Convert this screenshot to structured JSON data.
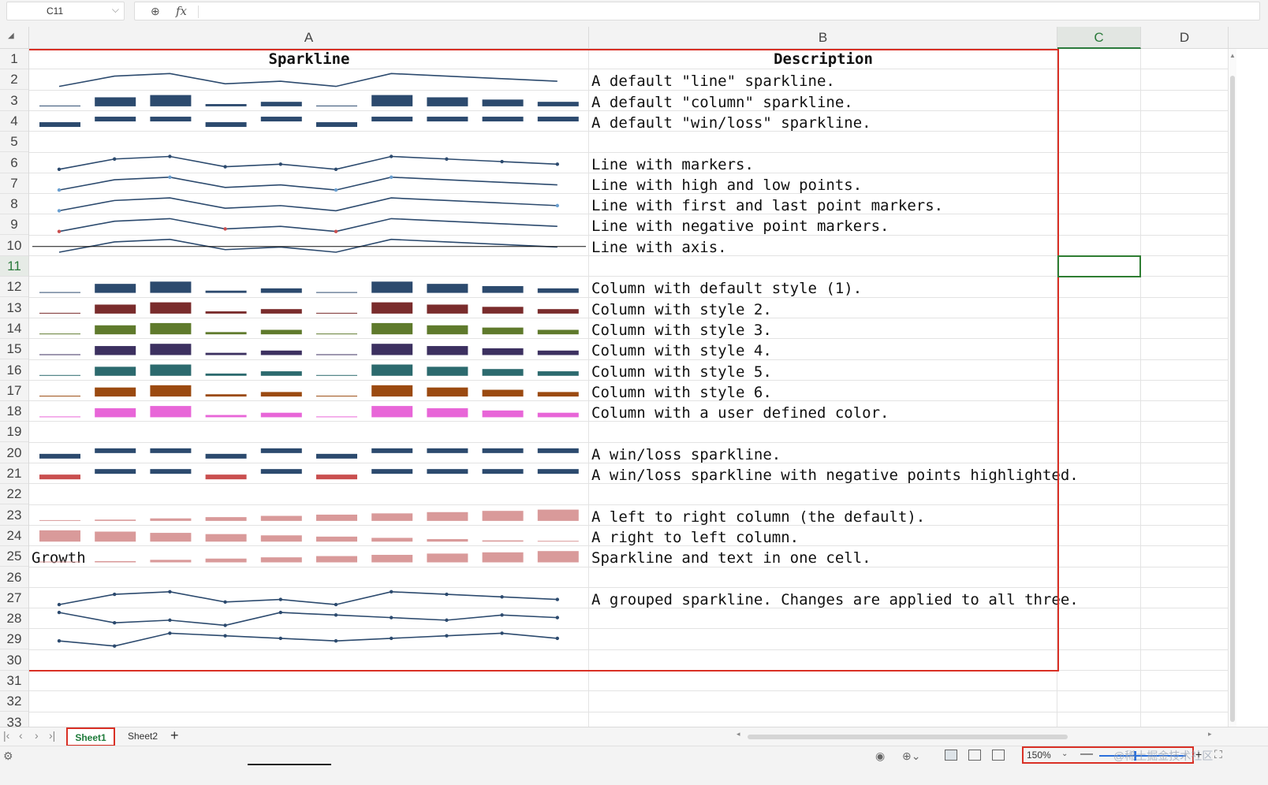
{
  "formula_bar": {
    "name_box": "C11",
    "fx": "fx",
    "content": ""
  },
  "columns": [
    "A",
    "B",
    "C",
    "D"
  ],
  "selected_column": "C",
  "selected_row": 11,
  "rows": [
    1,
    2,
    3,
    4,
    5,
    6,
    7,
    8,
    9,
    10,
    11,
    12,
    13,
    14,
    15,
    16,
    17,
    18,
    19,
    20,
    21,
    22,
    23,
    24,
    25,
    26,
    27,
    28,
    29,
    30,
    31,
    32,
    33
  ],
  "header": {
    "a": "Sparkline",
    "b": "Description"
  },
  "cells": [
    {
      "row": 2,
      "text": "A default \"line\" sparkline."
    },
    {
      "row": 3,
      "text": "A default \"column\" sparkline."
    },
    {
      "row": 4,
      "text": "A default \"win/loss\" sparkline."
    },
    {
      "row": 6,
      "text": "Line with markers."
    },
    {
      "row": 7,
      "text": "Line with high and low points."
    },
    {
      "row": 8,
      "text": "Line with first and last point markers."
    },
    {
      "row": 9,
      "text": "Line with negative point markers."
    },
    {
      "row": 10,
      "text": "Line with axis."
    },
    {
      "row": 12,
      "text": "Column with default style (1)."
    },
    {
      "row": 13,
      "text": "Column with style 2."
    },
    {
      "row": 14,
      "text": "Column with style 3."
    },
    {
      "row": 15,
      "text": "Column with style 4."
    },
    {
      "row": 16,
      "text": "Column with style 5."
    },
    {
      "row": 17,
      "text": "Column with style 6."
    },
    {
      "row": 18,
      "text": "Column with a user defined color."
    },
    {
      "row": 20,
      "text": "A win/loss sparkline."
    },
    {
      "row": 21,
      "text": "A win/loss sparkline with negative points highlighted."
    },
    {
      "row": 23,
      "text": "A left to right column (the default)."
    },
    {
      "row": 24,
      "text": "A right to left column."
    },
    {
      "row": 25,
      "text": "Sparkline and text in one cell."
    },
    {
      "row": 27,
      "text": "A grouped sparkline. Changes are applied to all three."
    }
  ],
  "a25_text": "Growth",
  "sparkline_data": {
    "series": [
      -2,
      2,
      3,
      -1,
      0,
      -2,
      3,
      2,
      1,
      0
    ],
    "ascending": [
      1,
      2,
      3,
      4,
      5,
      6,
      7,
      8,
      9,
      10
    ],
    "group1": [
      -2,
      2,
      3,
      -1,
      0,
      -2,
      3,
      2,
      1,
      0
    ],
    "group2": [
      3,
      -1,
      0,
      -2,
      3,
      2,
      1,
      0,
      2,
      1
    ],
    "group3": [
      0,
      -2,
      3,
      2,
      1,
      0,
      1,
      2,
      3,
      1
    ]
  },
  "colors": {
    "style1": "#2c4a6e",
    "style2": "#7a2c2c",
    "style3": "#5f7a2c",
    "style4": "#3c3060",
    "style5": "#2c6a6e",
    "style6": "#9b4a10",
    "user": "#e866d8",
    "negative": "#c94f4f",
    "rtl": "#d99a9a",
    "high_low": "#6a9fd0",
    "selection": "#2e7d32",
    "highlight_box": "#d93025"
  },
  "sheets": {
    "tabs": [
      "Sheet1",
      "Sheet2"
    ],
    "active": "Sheet1",
    "add_label": "+"
  },
  "status": {
    "zoom": "150%",
    "zoom_minus": "—",
    "zoom_plus": "+",
    "watermark": "@稀土掘金技术社区"
  }
}
